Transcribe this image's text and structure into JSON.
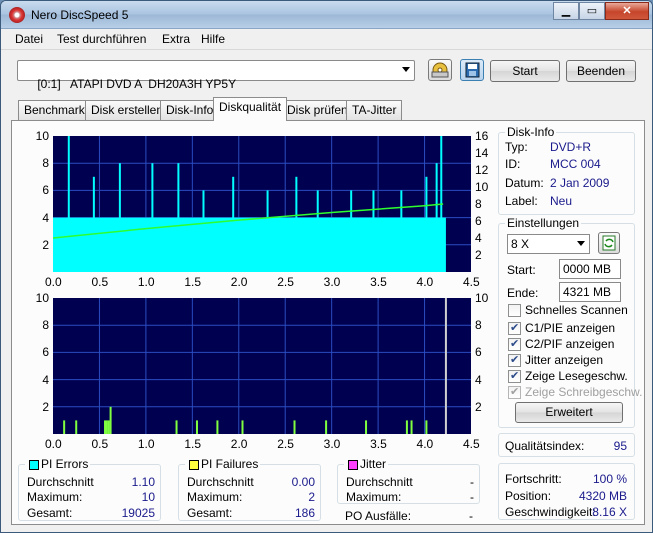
{
  "window": {
    "title": "Nero DiscSpeed 5"
  },
  "menu": [
    "Datei",
    "Test durchführen",
    "Extra",
    "Hilfe"
  ],
  "toolbar": {
    "drive": "[0:1]   ATAPI DVD A  DH20A3H YP5Y",
    "start_label": "Start",
    "end_label": "Beenden"
  },
  "tabs": [
    "Benchmark",
    "Disk erstellen",
    "Disk-Info",
    "Diskqualität",
    "Disk prüfen",
    "TA-Jitter"
  ],
  "active_tab": "Diskqualität",
  "chart_data": [
    {
      "type": "bar",
      "title": "",
      "xlabel": "",
      "ylabel": "",
      "xlim": [
        0,
        4.5
      ],
      "ylim": [
        0,
        10
      ],
      "y2lim": [
        0,
        16
      ],
      "x_ticks": [
        "0.0",
        "0.5",
        "1.0",
        "1.5",
        "2.0",
        "2.5",
        "3.0",
        "3.5",
        "4.0",
        "4.5"
      ],
      "y_ticks": [
        "2",
        "4",
        "6",
        "8",
        "10"
      ],
      "y2_ticks": [
        "2",
        "4",
        "6",
        "8",
        "10",
        "12",
        "14",
        "16"
      ],
      "grid": true,
      "series": [
        {
          "values_approx_note": "",
          "color": "#00ffff",
          "x": [
            0.0,
            0.1,
            0.2,
            0.3,
            0.4,
            0.5,
            0.6,
            0.7,
            0.8,
            0.9,
            1.0,
            1.1,
            1.2,
            1.3,
            1.4,
            1.5,
            1.6,
            1.7,
            1.8,
            1.9,
            2.0,
            2.1,
            2.2,
            2.3,
            2.4,
            2.5,
            2.6,
            2.7,
            2.8,
            2.9,
            3.0,
            3.1,
            3.2,
            3.3,
            3.4,
            3.5,
            3.6,
            3.7,
            3.8,
            3.9,
            4.0,
            4.1,
            4.2
          ],
          "values": [
            4,
            4,
            4,
            4,
            4,
            4,
            4,
            4,
            4,
            4,
            4,
            4,
            4,
            4,
            4,
            4,
            4,
            4,
            4,
            4,
            4,
            4,
            4,
            4,
            4,
            4,
            4,
            4,
            4,
            4,
            4,
            4,
            4,
            4,
            4,
            4,
            4,
            4,
            4,
            4,
            4,
            4,
            4
          ]
        }
      ],
      "spikes": [
        {
          "x": 0.17,
          "y": 10
        },
        {
          "x": 0.44,
          "y": 7
        },
        {
          "x": 0.72,
          "y": 8
        },
        {
          "x": 1.07,
          "y": 8
        },
        {
          "x": 1.35,
          "y": 8
        },
        {
          "x": 1.62,
          "y": 6
        },
        {
          "x": 1.94,
          "y": 7
        },
        {
          "x": 2.31,
          "y": 6
        },
        {
          "x": 2.62,
          "y": 7
        },
        {
          "x": 2.85,
          "y": 6
        },
        {
          "x": 3.21,
          "y": 6
        },
        {
          "x": 3.45,
          "y": 6
        },
        {
          "x": 3.75,
          "y": 6
        },
        {
          "x": 4.02,
          "y": 7
        },
        {
          "x": 4.13,
          "y": 8
        },
        {
          "x": 4.18,
          "y": 10
        }
      ],
      "speed_line": {
        "color": "#2eff2e",
        "x": [
          0.0,
          1.0,
          2.0,
          3.0,
          4.0,
          4.2
        ],
        "y2": [
          4,
          5.1,
          6.1,
          7.0,
          7.8,
          8.0
        ]
      }
    },
    {
      "type": "bar",
      "title": "",
      "xlim": [
        0,
        4.5
      ],
      "ylim": [
        0,
        10
      ],
      "x_ticks": [
        "0.0",
        "0.5",
        "1.0",
        "1.5",
        "2.0",
        "2.5",
        "3.0",
        "3.5",
        "4.0",
        "4.5"
      ],
      "y_ticks": [
        "2",
        "4",
        "6",
        "8",
        "10"
      ],
      "y2_ticks": [
        "2",
        "4",
        "6",
        "8",
        "10"
      ],
      "grid": true,
      "series": [
        {
          "color": "#80ff40",
          "x": [
            0.12,
            0.25,
            0.56,
            0.58,
            0.6,
            0.62,
            1.33,
            1.55,
            1.77,
            2.04,
            2.6,
            2.94,
            3.37,
            3.81,
            3.86,
            4.02
          ],
          "values": [
            1,
            1,
            1,
            1,
            1,
            2,
            1,
            1,
            1,
            1,
            1,
            1,
            1,
            1,
            1,
            1
          ]
        }
      ],
      "markers": [
        {
          "x": 4.23,
          "color": "#d0d0d0"
        }
      ]
    }
  ],
  "disk_info": {
    "title": "Disk-Info",
    "rows": [
      {
        "label": "Typ:",
        "value": "DVD+R"
      },
      {
        "label": "ID:",
        "value": "MCC 004"
      },
      {
        "label": "Datum:",
        "value": "2 Jan 2009"
      },
      {
        "label": "Label:",
        "value": "Neu"
      }
    ]
  },
  "settings": {
    "title": "Einstellungen",
    "speed": "8 X",
    "start_label": "Start:",
    "start_value": "0000 MB",
    "end_label": "Ende:",
    "end_value": "4321 MB",
    "options": [
      {
        "label": "Schnelles Scannen",
        "checked": false,
        "disabled": false
      },
      {
        "label": "C1/PIE anzeigen",
        "checked": true,
        "disabled": false
      },
      {
        "label": "C2/PIF anzeigen",
        "checked": true,
        "disabled": false
      },
      {
        "label": "Jitter anzeigen",
        "checked": true,
        "disabled": false
      },
      {
        "label": "Zeige Lesegeschw.",
        "checked": true,
        "disabled": false
      },
      {
        "label": "Zeige Schreibgeschw.",
        "checked": true,
        "disabled": true
      }
    ],
    "advanced_label": "Erweitert"
  },
  "quality": {
    "label": "Qualitätsindex:",
    "value": "95"
  },
  "progress": {
    "rows": [
      {
        "label": "Fortschritt:",
        "value": "100 %"
      },
      {
        "label": "Position:",
        "value": "4320 MB"
      },
      {
        "label": "Geschwindigkeit:",
        "value": "8.16 X"
      }
    ]
  },
  "pi_errors": {
    "title": "PI Errors",
    "color": "#00ffff",
    "rows": [
      {
        "label": "Durchschnitt",
        "value": "1.10"
      },
      {
        "label": "Maximum:",
        "value": "10"
      },
      {
        "label": "Gesamt:",
        "value": "19025"
      }
    ]
  },
  "pi_failures": {
    "title": "PI Failures",
    "color": "#ffff40",
    "rows": [
      {
        "label": "Durchschnitt",
        "value": "0.00"
      },
      {
        "label": "Maximum:",
        "value": "2"
      },
      {
        "label": "Gesamt:",
        "value": "186"
      }
    ]
  },
  "jitter": {
    "title": "Jitter",
    "color": "#ff40ff",
    "rows": [
      {
        "label": "Durchschnitt",
        "value": "-"
      },
      {
        "label": "Maximum:",
        "value": "-"
      }
    ],
    "po_label": "PO Ausfälle:",
    "po_value": "-"
  }
}
